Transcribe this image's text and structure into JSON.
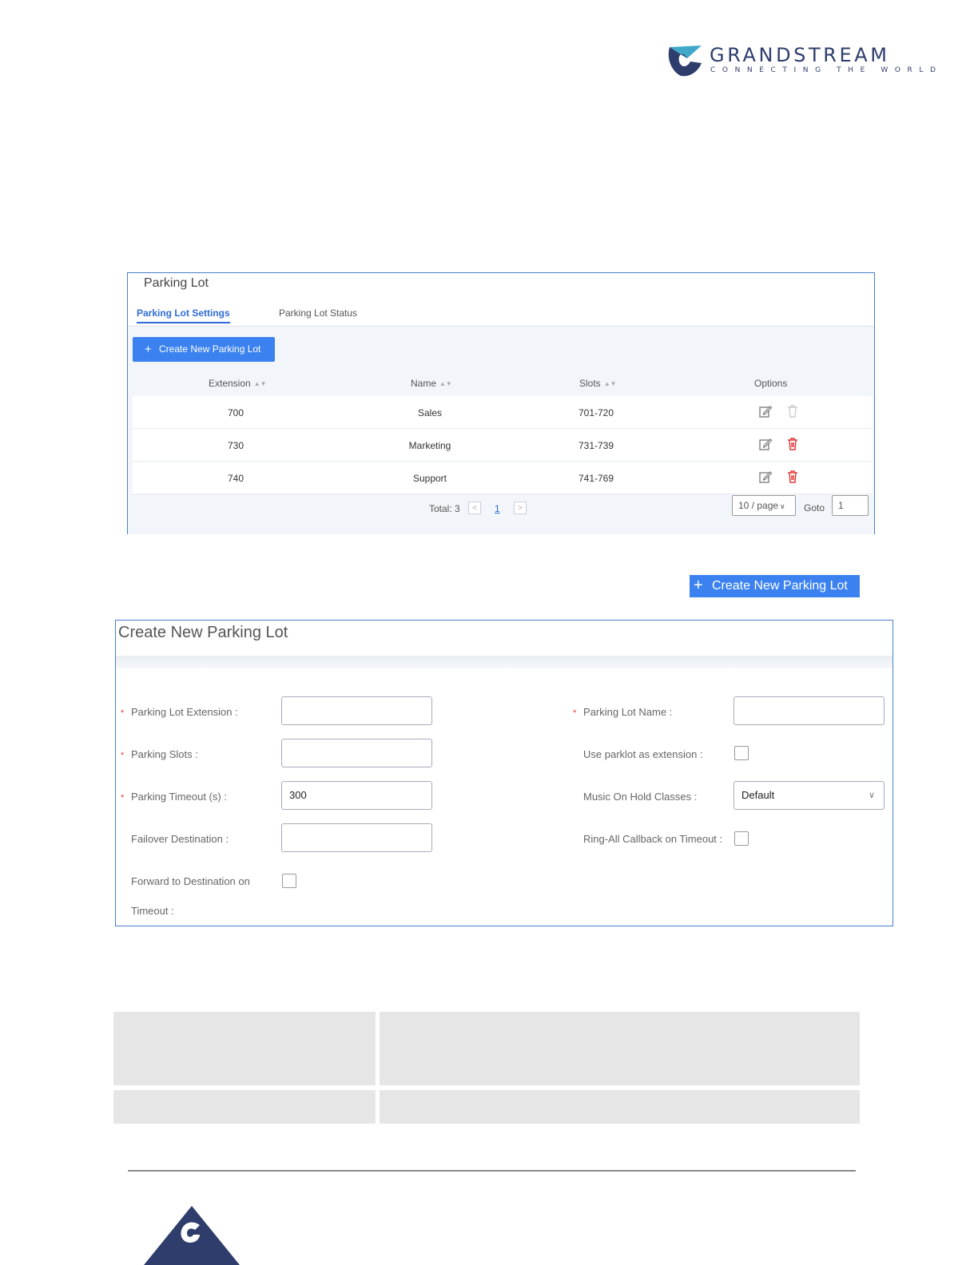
{
  "brand": {
    "name": "GRANDSTREAM",
    "tagline": "CONNECTING THE WORLD",
    "colors": {
      "brand_navy": "#2e3d6c",
      "brand_teal": "#3fa8c8",
      "accent_blue": "#3b82f0",
      "danger_red": "#e23a3a"
    }
  },
  "parking_lot_panel": {
    "title": "Parking Lot",
    "tabs": [
      {
        "label": "Parking Lot Settings",
        "active": true
      },
      {
        "label": "Parking Lot Status",
        "active": false
      }
    ],
    "create_button": {
      "icon": "plus-icon",
      "label": "Create New Parking Lot"
    },
    "table": {
      "columns": [
        "Extension",
        "Name",
        "Slots",
        "Options"
      ],
      "rows": [
        {
          "extension": "700",
          "name": "Sales",
          "slots": "701-720",
          "delete_enabled": false
        },
        {
          "extension": "730",
          "name": "Marketing",
          "slots": "731-739",
          "delete_enabled": true
        },
        {
          "extension": "740",
          "name": "Support",
          "slots": "741-769",
          "delete_enabled": true
        }
      ]
    },
    "pagination": {
      "total": "Total: 3",
      "prev": "<",
      "current_page": "1",
      "next": ">",
      "page_size": "10 / page",
      "goto_label": "Goto",
      "goto_value": "1"
    }
  },
  "create_button_image": {
    "icon": "plus-icon",
    "label": "Create New Parking Lot"
  },
  "create_form": {
    "title": "Create New Parking Lot",
    "fields": {
      "parking_lot_extension": {
        "label": "Parking Lot Extension :",
        "required": true,
        "value": ""
      },
      "parking_slots": {
        "label": "Parking Slots :",
        "required": true,
        "value": ""
      },
      "parking_timeout": {
        "label": "Parking Timeout (s) :",
        "required": true,
        "value": "300"
      },
      "failover_destination": {
        "label": "Failover Destination :",
        "required": false,
        "value": ""
      },
      "forward_to_destination": {
        "label_line1": "Forward to Destination on",
        "label_line2": "Timeout :",
        "checked": false
      },
      "parking_lot_name": {
        "label": "Parking Lot Name :",
        "required": true,
        "value": ""
      },
      "use_parklot_as_extension": {
        "label": "Use parklot as extension :",
        "checked": false
      },
      "music_on_hold_classes": {
        "label": "Music On Hold Classes :",
        "value": "Default"
      },
      "ring_all_callback": {
        "label": "Ring-All Callback on Timeout :",
        "checked": false
      }
    }
  }
}
